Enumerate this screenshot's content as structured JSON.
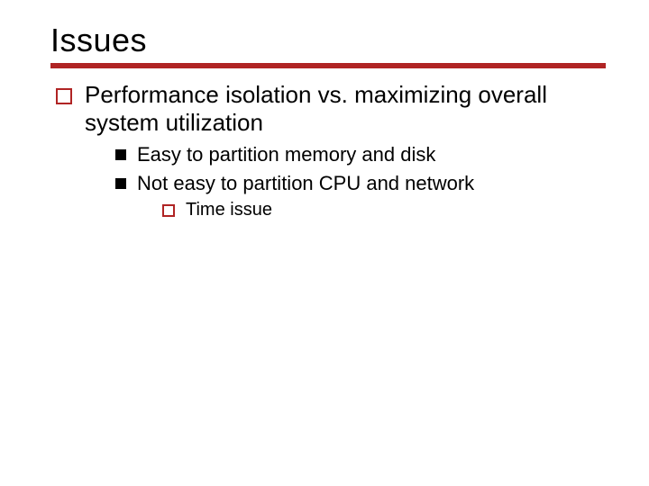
{
  "title": "Issues",
  "bullets": {
    "l1_0": "Performance isolation vs. maximizing overall system utilization",
    "l2_0": "Easy to partition memory and disk",
    "l2_1": "Not easy to partition CPU and network",
    "l3_0": "Time issue"
  }
}
